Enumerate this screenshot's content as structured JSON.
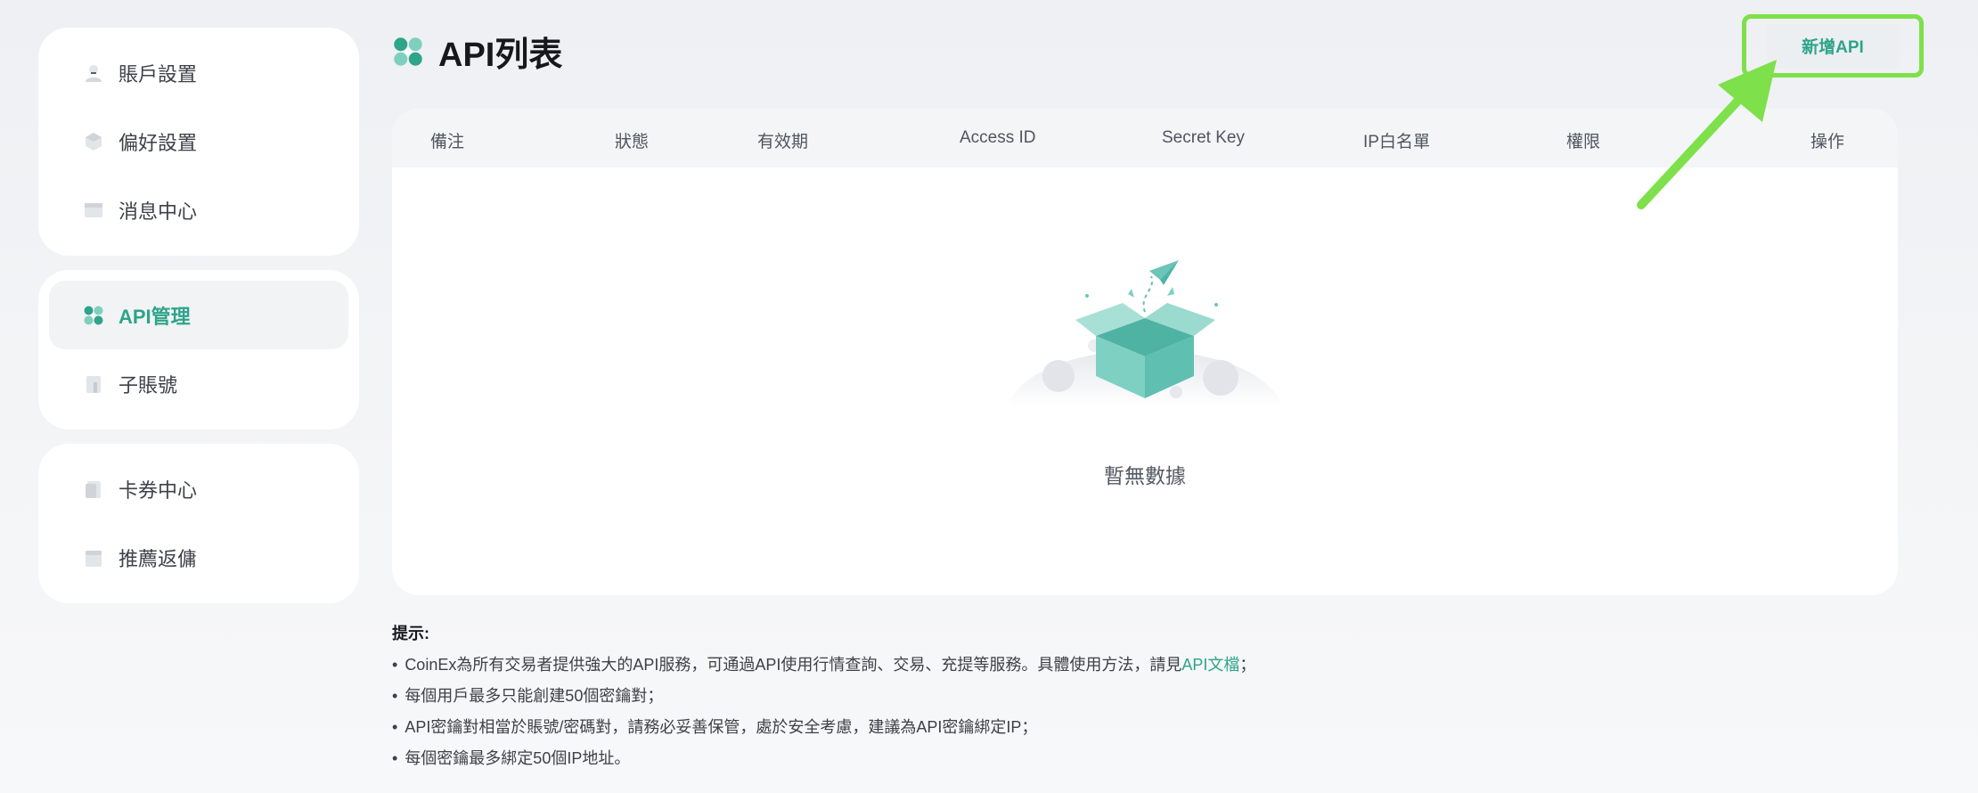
{
  "sidebar": {
    "groups": [
      {
        "items": [
          {
            "label": "賬戶設置",
            "icon": "user-icon"
          },
          {
            "label": "偏好設置",
            "icon": "preferences-icon"
          },
          {
            "label": "消息中心",
            "icon": "message-icon"
          }
        ]
      },
      {
        "items": [
          {
            "label": "API管理",
            "icon": "api-icon",
            "active": true
          },
          {
            "label": "子賬號",
            "icon": "sub-account-icon"
          }
        ]
      },
      {
        "items": [
          {
            "label": "卡券中心",
            "icon": "coupon-icon"
          },
          {
            "label": "推薦返傭",
            "icon": "referral-icon"
          }
        ]
      }
    ]
  },
  "header": {
    "title": "API列表",
    "add_button": "新增API"
  },
  "table": {
    "columns": [
      "備注",
      "狀態",
      "有效期",
      "Access ID",
      "Secret Key",
      "IP白名單",
      "權限",
      "操作"
    ],
    "empty_text": "暫無數據"
  },
  "tips": {
    "title": "提示:",
    "line1_before": "CoinEx為所有交易者提供強大的API服務，可通過API使用行情查詢、交易、充提等服務。具體使用方法，請見",
    "line1_link": "API文檔",
    "line1_after": "；",
    "line2": "每個用戶最多只能創建50個密鑰對；",
    "line3": "API密鑰對相當於賬號/密碼對，請務必妥善保管，處於安全考慮，建議為API密鑰綁定IP；",
    "line4": "每個密鑰最多綁定50個IP地址。",
    "bullet": "•"
  },
  "colors": {
    "accent": "#2ea48a",
    "highlight": "#7ee04a"
  }
}
